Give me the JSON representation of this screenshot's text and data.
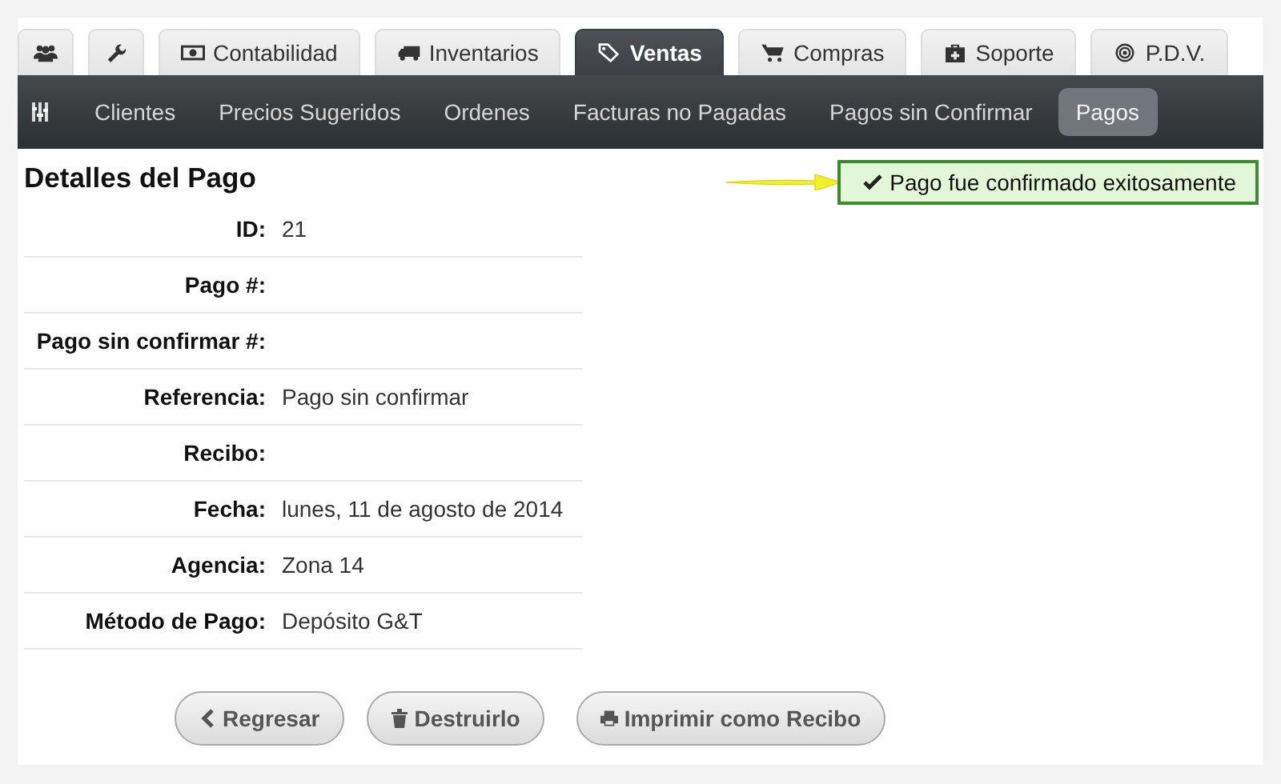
{
  "tabs": [
    {
      "selected": false
    },
    {
      "selected": false
    },
    {
      "label": "Contabilidad",
      "selected": false
    },
    {
      "label": "Inventarios",
      "selected": false
    },
    {
      "label": "Ventas",
      "selected": true
    },
    {
      "label": "Compras",
      "selected": false
    },
    {
      "label": "Soporte",
      "selected": false
    },
    {
      "label": "P.D.V.",
      "selected": false
    }
  ],
  "subnav": [
    {
      "label": "Clientes",
      "selected": false
    },
    {
      "label": "Precios Sugeridos",
      "selected": false
    },
    {
      "label": "Ordenes",
      "selected": false
    },
    {
      "label": "Facturas no Pagadas",
      "selected": false
    },
    {
      "label": "Pagos sin Confirmar",
      "selected": false
    },
    {
      "label": "Pagos",
      "selected": true
    }
  ],
  "title": "Detalles del Pago",
  "alert": {
    "message": "Pago fue confirmado exitosamente"
  },
  "details": [
    {
      "label": "ID:",
      "value": "21"
    },
    {
      "label": "Pago #:"
    },
    {
      "label": "Pago sin confirmar #:"
    },
    {
      "label": "Referencia:",
      "value": "Pago sin confirmar"
    },
    {
      "label": "Recibo:"
    },
    {
      "label": "Fecha:",
      "value": "lunes, 11 de agosto de 2014"
    },
    {
      "label": "Agencia:",
      "value": "Zona 14"
    },
    {
      "label": "Método de Pago:",
      "value": "Depósito G&T"
    }
  ],
  "buttons": [
    "Regresar",
    "Destruirlo",
    "Imprimir como Recibo"
  ]
}
